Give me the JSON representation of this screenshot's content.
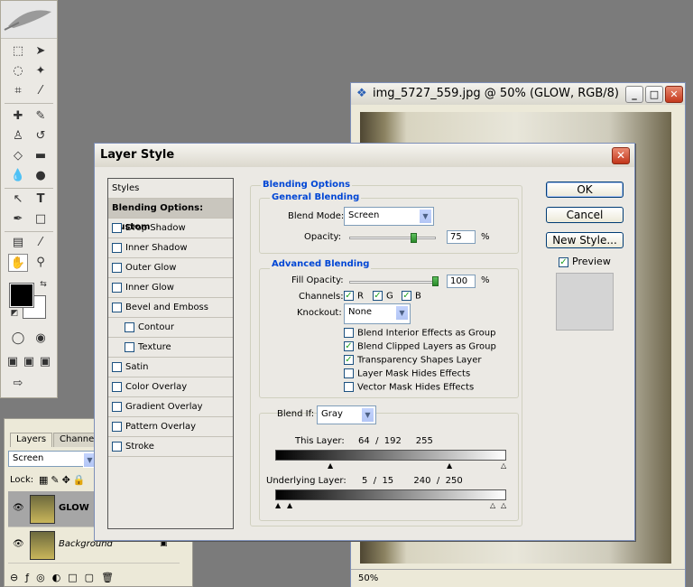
{
  "document": {
    "title": "img_5727_559.jpg @ 50% (GLOW, RGB/8)",
    "zoom": "50%"
  },
  "layers_panel": {
    "tabs": [
      "Layers",
      "Channels"
    ],
    "blend_mode": "Screen",
    "lock_label": "Lock:",
    "layers": [
      {
        "name": "GLOW",
        "selected": true
      },
      {
        "name": "Background",
        "selected": false
      }
    ]
  },
  "dialog": {
    "title": "Layer Style",
    "styles_header": "Styles",
    "style_items": [
      {
        "label": "Blending Options: Custom",
        "checkbox": false,
        "selected": true,
        "indent": false
      },
      {
        "label": "Drop Shadow",
        "checkbox": true,
        "checked": false,
        "indent": false
      },
      {
        "label": "Inner Shadow",
        "checkbox": true,
        "checked": false,
        "indent": false
      },
      {
        "label": "Outer Glow",
        "checkbox": true,
        "checked": false,
        "indent": false
      },
      {
        "label": "Inner Glow",
        "checkbox": true,
        "checked": false,
        "indent": false
      },
      {
        "label": "Bevel and Emboss",
        "checkbox": true,
        "checked": false,
        "indent": false
      },
      {
        "label": "Contour",
        "checkbox": true,
        "checked": false,
        "indent": true
      },
      {
        "label": "Texture",
        "checkbox": true,
        "checked": false,
        "indent": true
      },
      {
        "label": "Satin",
        "checkbox": true,
        "checked": false,
        "indent": false
      },
      {
        "label": "Color Overlay",
        "checkbox": true,
        "checked": false,
        "indent": false
      },
      {
        "label": "Gradient Overlay",
        "checkbox": true,
        "checked": false,
        "indent": false
      },
      {
        "label": "Pattern Overlay",
        "checkbox": true,
        "checked": false,
        "indent": false
      },
      {
        "label": "Stroke",
        "checkbox": true,
        "checked": false,
        "indent": false
      }
    ],
    "blending_options": {
      "title": "Blending Options",
      "general_title": "General Blending",
      "blend_mode_label": "Blend Mode:",
      "blend_mode_value": "Screen",
      "opacity_label": "Opacity:",
      "opacity_value": "75",
      "opacity_fraction": 0.75,
      "percent": "%"
    },
    "advanced": {
      "title": "Advanced Blending",
      "fill_opacity_label": "Fill Opacity:",
      "fill_opacity_value": "100",
      "fill_opacity_fraction": 1.0,
      "percent": "%",
      "channels_label": "Channels:",
      "channels": [
        {
          "label": "R",
          "checked": true
        },
        {
          "label": "G",
          "checked": true
        },
        {
          "label": "B",
          "checked": true
        }
      ],
      "knockout_label": "Knockout:",
      "knockout_value": "None",
      "options": [
        {
          "label": "Blend Interior Effects as Group",
          "checked": false
        },
        {
          "label": "Blend Clipped Layers as Group",
          "checked": true
        },
        {
          "label": "Transparency Shapes Layer",
          "checked": true
        },
        {
          "label": "Layer Mask Hides Effects",
          "checked": false
        },
        {
          "label": "Vector Mask Hides Effects",
          "checked": false
        }
      ]
    },
    "blend_if": {
      "label": "Blend If:",
      "value": "Gray",
      "this_layer_label": "This Layer:",
      "this_layer_values": "64  /  192     255",
      "underlying_label": "Underlying Layer:",
      "underlying_values": "5  /  15       240  /  250"
    },
    "buttons": {
      "ok": "OK",
      "cancel": "Cancel",
      "new_style": "New Style...",
      "preview_label": "Preview",
      "preview_checked": true
    }
  }
}
